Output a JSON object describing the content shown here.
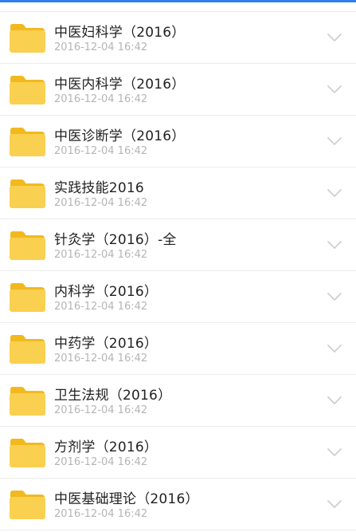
{
  "colors": {
    "accent": "#2f80ed",
    "folder": "#f9d04f",
    "folder_tab": "#f2b91f",
    "date": "#b5b5b5",
    "divider": "#ececec"
  },
  "items": [
    {
      "name": "中医妇科学（2016）",
      "date": "2016-12-04 16:42",
      "icon": "folder-icon"
    },
    {
      "name": "中医内科学（2016）",
      "date": "2016-12-04 16:42",
      "icon": "folder-icon"
    },
    {
      "name": "中医诊断学（2016）",
      "date": "2016-12-04 16:42",
      "icon": "folder-icon"
    },
    {
      "name": "实践技能2016",
      "date": "2016-12-04 16:42",
      "icon": "folder-icon"
    },
    {
      "name": "针灸学（2016）-全",
      "date": "2016-12-04 16:42",
      "icon": "folder-icon"
    },
    {
      "name": "内科学（2016）",
      "date": "2016-12-04 16:42",
      "icon": "folder-icon"
    },
    {
      "name": "中药学（2016）",
      "date": "2016-12-04 16:42",
      "icon": "folder-icon"
    },
    {
      "name": "卫生法规（2016）",
      "date": "2016-12-04 16:42",
      "icon": "folder-icon"
    },
    {
      "name": "方剂学（2016）",
      "date": "2016-12-04 16:42",
      "icon": "folder-icon"
    },
    {
      "name": "中医基础理论（2016）",
      "date": "2016-12-04 16:42",
      "icon": "folder-icon"
    }
  ]
}
